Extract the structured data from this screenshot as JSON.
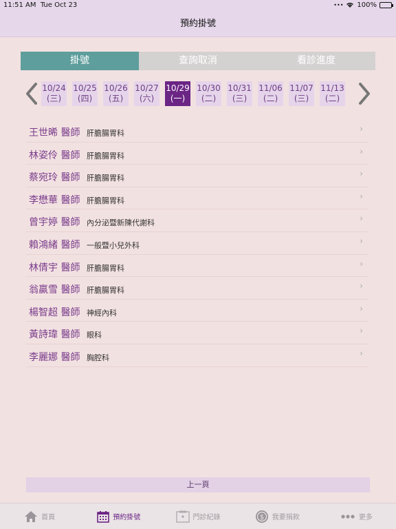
{
  "status_bar": {
    "time": "11:51 AM",
    "date": "Tue Oct 23",
    "battery": "100%"
  },
  "nav": {
    "title": "預約掛號"
  },
  "tabs": [
    {
      "label": "掛號",
      "active": true
    },
    {
      "label": "查詢取消",
      "active": false
    },
    {
      "label": "看診進度",
      "active": false
    }
  ],
  "dates": [
    {
      "date": "10/24",
      "weekday": "(三)"
    },
    {
      "date": "10/25",
      "weekday": "(四)"
    },
    {
      "date": "10/26",
      "weekday": "(五)"
    },
    {
      "date": "10/27",
      "weekday": "(六)"
    },
    {
      "date": "10/29",
      "weekday": "(一)",
      "selected": true
    },
    {
      "date": "10/30",
      "weekday": "(二)"
    },
    {
      "date": "10/31",
      "weekday": "(三)"
    },
    {
      "date": "11/06",
      "weekday": "(二)"
    },
    {
      "date": "11/07",
      "weekday": "(三)"
    },
    {
      "date": "11/13",
      "weekday": "(二)"
    }
  ],
  "doctors": [
    {
      "name": "王世晞 醫師",
      "dept": "肝膽腸胃科"
    },
    {
      "name": "林姿伶 醫師",
      "dept": "肝膽腸胃科"
    },
    {
      "name": "蔡宛玲 醫師",
      "dept": "肝膽腸胃科"
    },
    {
      "name": "李懋華 醫師",
      "dept": "肝膽腸胃科"
    },
    {
      "name": "曾宇婷 醫師",
      "dept": "內分泌暨新陳代謝科"
    },
    {
      "name": "賴鴻緒 醫師",
      "dept": "一般暨小兒外科"
    },
    {
      "name": "林倩宇 醫師",
      "dept": "肝膽腸胃科"
    },
    {
      "name": "翁贏雪 醫師",
      "dept": "肝膽腸胃科"
    },
    {
      "name": "楊智超 醫師",
      "dept": "神經內科"
    },
    {
      "name": "黃詩瑋 醫師",
      "dept": "眼科"
    },
    {
      "name": "李麗娜 醫師",
      "dept": "胸腔科"
    }
  ],
  "pagination": {
    "prev_label": "上一頁"
  },
  "tab_bar": [
    {
      "label": "首頁",
      "icon": "home-icon",
      "active": false
    },
    {
      "label": "預約掛號",
      "icon": "calendar-icon",
      "active": true
    },
    {
      "label": "門診紀錄",
      "icon": "records-icon",
      "active": false
    },
    {
      "label": "我要捐款",
      "icon": "donate-icon",
      "active": false
    },
    {
      "label": "更多",
      "icon": "more-icon",
      "active": false
    }
  ],
  "colors": {
    "accent": "#6b2585",
    "tab_active": "#5e9e9c",
    "background": "#f2e1e1"
  }
}
